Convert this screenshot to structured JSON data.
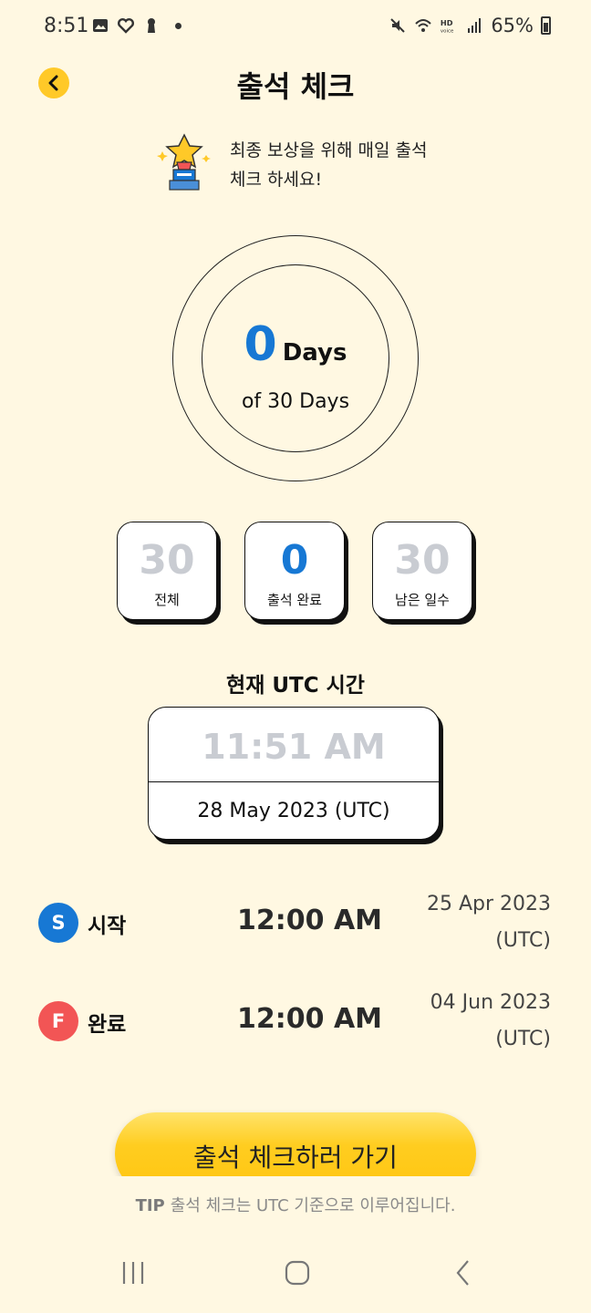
{
  "status_bar": {
    "time": "8:51",
    "battery": "65%",
    "icons": [
      "image-icon",
      "heart-icon",
      "keyhole-icon",
      "dot-icon",
      "mute-icon",
      "wifi-icon",
      "hd-voice-icon",
      "signal-icon",
      "battery-icon"
    ]
  },
  "header": {
    "title": "출석 체크",
    "back_icon": "chevron-left-icon"
  },
  "intro": {
    "line1": "최종 보상을 위해 매일 출석",
    "line2": "체크 하세요!",
    "icon": "trophy-star-icon"
  },
  "progress": {
    "count": "0",
    "unit": "Days",
    "total": "of 30 Days"
  },
  "stats": [
    {
      "value": "30",
      "label": "전체"
    },
    {
      "value": "0",
      "label": "출석 완료"
    },
    {
      "value": "30",
      "label": "남은 일수"
    }
  ],
  "utc": {
    "title": "현재 UTC 시간",
    "time": "11:51 AM",
    "date": "28 May 2023 (UTC)"
  },
  "schedule": {
    "start": {
      "badge": "S",
      "label": "시작",
      "time": "12:00 AM",
      "date_line1": "25 Apr 2023",
      "date_line2": "(UTC)"
    },
    "finish": {
      "badge": "F",
      "label": "완료",
      "time": "12:00 AM",
      "date_line1": "04 Jun 2023",
      "date_line2": "(UTC)"
    }
  },
  "cta": {
    "label": "출석 체크하러 가기"
  },
  "tip": {
    "prefix": "TIP",
    "text": "출석 체크는 UTC 기준으로 이루어집니다."
  },
  "colors": {
    "background": "#FFF8E2",
    "accent_yellow": "#FFC928",
    "blue": "#1778D4",
    "red": "#F25555",
    "gray_text": "#C9CCD2"
  }
}
